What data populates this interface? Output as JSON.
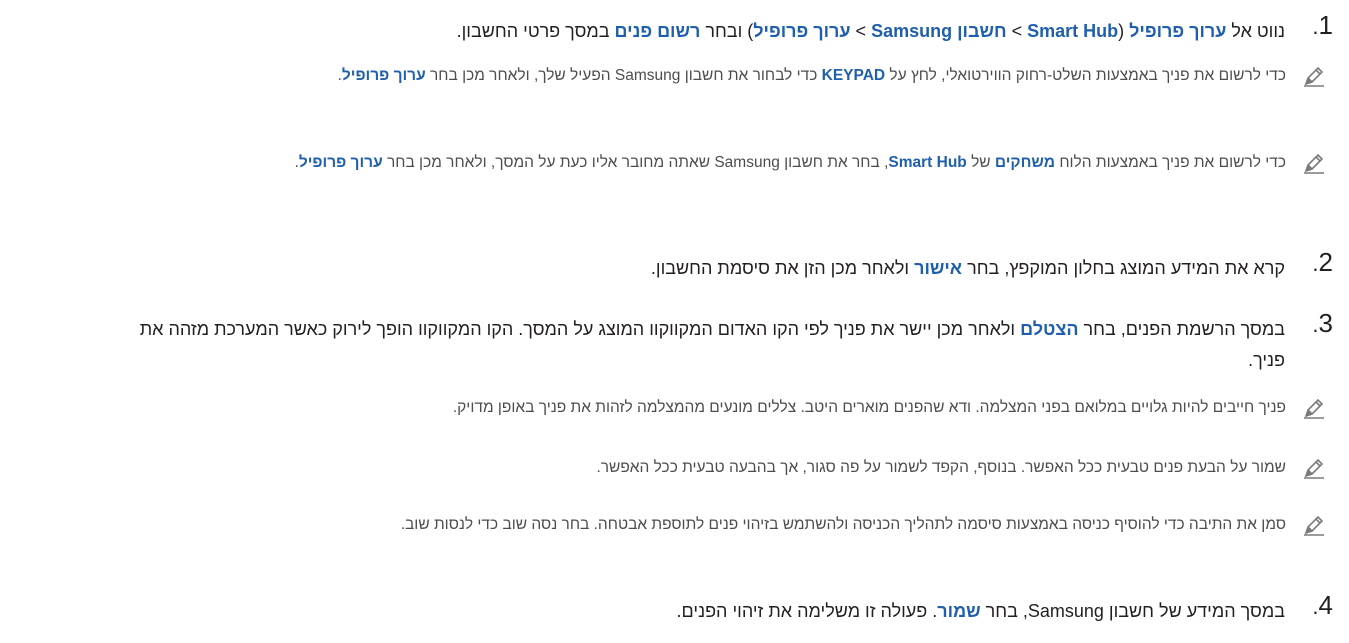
{
  "colors": {
    "text": "#231f20",
    "note_text": "#4d4d4f",
    "highlight": "#1f5fad",
    "icon": "#7a7a7a"
  },
  "icons": {
    "note": "pencil-note-icon"
  },
  "steps": [
    {
      "number": "1",
      "parts": [
        {
          "t": "נווט אל "
        },
        {
          "t": "ערוך פרופיל",
          "h": true
        },
        {
          "t": " ("
        },
        {
          "t": "Smart Hub",
          "h": true
        },
        {
          "t": " > "
        },
        {
          "t": "חשבון Samsung",
          "h": true
        },
        {
          "t": " > "
        },
        {
          "t": "ערוך פרופיל",
          "h": true
        },
        {
          "t": ") ובחר "
        },
        {
          "t": "רשום פנים",
          "h": true
        },
        {
          "t": " במסך פרטי החשבון."
        }
      ]
    },
    {
      "number": "2",
      "parts": [
        {
          "t": "קרא את המידע המוצג בחלון המוקפץ, בחר "
        },
        {
          "t": "אישור",
          "h": true
        },
        {
          "t": " ולאחר מכן הזן את סיסמת החשבון."
        }
      ]
    },
    {
      "number": "3",
      "parts": [
        {
          "t": "במסך הרשמת הפנים, בחר "
        },
        {
          "t": "הצטלם",
          "h": true
        },
        {
          "t": " ולאחר מכן יישר את פניך לפי הקו האדום המקווקוו המוצג על המסך. הקו המקווקוו הופך לירוק כאשר המערכת מזהה את פניך."
        }
      ]
    },
    {
      "number": "4",
      "parts": [
        {
          "t": "במסך המידע של חשבון Samsung, בחר "
        },
        {
          "t": "שמור",
          "h": true
        },
        {
          "t": ". פעולה זו משלימה את זיהוי הפנים."
        }
      ]
    }
  ],
  "notes": [
    {
      "parts": [
        {
          "t": "כדי לרשום את פניך באמצעות השלט-רחוק הווירטואלי, לחץ על "
        },
        {
          "t": "KEYPAD",
          "h": true
        },
        {
          "t": " כדי לבחור את חשבון Samsung הפעיל שלך, ולאחר מכן בחר "
        },
        {
          "t": "ערוך פרופיל",
          "h": true
        },
        {
          "t": "."
        }
      ]
    },
    {
      "parts": [
        {
          "t": "כדי לרשום את פניך באמצעות הלוח "
        },
        {
          "t": "משחקים",
          "h": true
        },
        {
          "t": " של "
        },
        {
          "t": "Smart Hub",
          "h": true
        },
        {
          "t": ", בחר את חשבון Samsung שאתה מחובר אליו כעת על המסך, ולאחר מכן בחר "
        },
        {
          "t": "ערוך פרופיל",
          "h": true
        },
        {
          "t": "."
        }
      ]
    },
    {
      "parts": [
        {
          "t": "פניך חייבים להיות גלויים במלואם בפני המצלמה. ודא שהפנים מוארים היטב. צללים מונעים מהמצלמה לזהות את פניך באופן מדויק."
        }
      ]
    },
    {
      "parts": [
        {
          "t": "שמור על הבעת פנים טבעית ככל האפשר. בנוסף, הקפד לשמור על פה סגור, אך בהבעה טבעית ככל האפשר."
        }
      ]
    },
    {
      "parts": [
        {
          "t": "סמן את התיבה כדי להוסיף כניסה באמצעות סיסמה לתהליך הכניסה ולהשתמש בזיהוי פנים לתוספת אבטחה. בחר נסה שוב כדי לנסות שוב."
        }
      ]
    }
  ]
}
